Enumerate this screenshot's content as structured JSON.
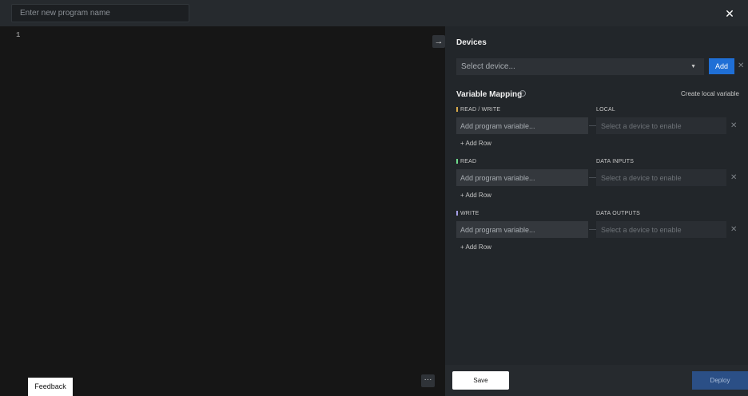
{
  "header": {
    "program_name_placeholder": "Enter new program name",
    "close_glyph": "✕"
  },
  "editor": {
    "line_number": "1",
    "collapse_glyph": "→",
    "more_glyph": "···",
    "feedback_label": "Feedback"
  },
  "devices": {
    "title": "Devices",
    "select_placeholder": "Select device...",
    "caret_glyph": "▼",
    "add_label": "Add",
    "remove_glyph": "✕"
  },
  "mapping": {
    "title": "Variable Mapping",
    "info_glyph": "i",
    "create_local_label": "Create local variable",
    "sections": [
      {
        "label": "READ / WRITE",
        "right_label": "LOCAL",
        "marker_color": "#d6a94a",
        "var_placeholder": "Add program variable...",
        "device_placeholder": "Select a device to enable",
        "add_row_label": "+ Add Row",
        "remove_glyph": "✕"
      },
      {
        "label": "READ",
        "right_label": "DATA INPUTS",
        "marker_color": "#6fdc8c",
        "var_placeholder": "Add program variable...",
        "device_placeholder": "Select a device to enable",
        "add_row_label": "+ Add Row",
        "remove_glyph": "✕"
      },
      {
        "label": "WRITE",
        "right_label": "DATA OUTPUTS",
        "marker_color": "#a59ee6",
        "var_placeholder": "Add program variable...",
        "device_placeholder": "Select a device to enable",
        "add_row_label": "+ Add Row",
        "remove_glyph": "✕"
      }
    ]
  },
  "footer": {
    "save_label": "Save",
    "deploy_label": "Deploy"
  },
  "colors": {
    "accent": "#1f6fd6",
    "panel": "#22262a",
    "editor": "#161616"
  }
}
